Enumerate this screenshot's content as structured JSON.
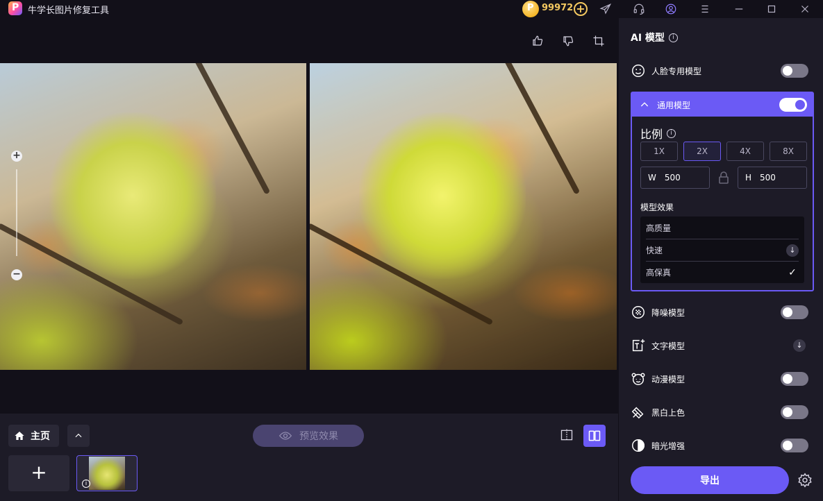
{
  "titlebar": {
    "app_title": "牛学长图片修复工具",
    "coin_count": "99972",
    "icons": [
      "send-icon",
      "headset-icon",
      "user-icon",
      "menu-icon",
      "minimize-icon",
      "maximize-icon",
      "close-icon"
    ]
  },
  "canvas": {
    "tools": [
      "thumbs-up-icon",
      "thumbs-down-icon",
      "crop-icon"
    ],
    "zoom": {
      "plus": "+",
      "minus": "−"
    }
  },
  "bottom": {
    "home_label": "主页",
    "preview_label": "预览效果",
    "add_label": "+",
    "thumbnail_info": "i"
  },
  "panel": {
    "title": "AI 模型",
    "models": {
      "face": {
        "label": "人脸专用模型",
        "enabled": false
      },
      "general": {
        "label": "通用模型",
        "enabled": true
      },
      "denoise": {
        "label": "降噪模型",
        "enabled": false
      },
      "text": {
        "label": "文字模型",
        "download": true
      },
      "anime": {
        "label": "动漫模型",
        "enabled": false
      },
      "colorize": {
        "label": "黑白上色",
        "enabled": false
      },
      "lowlight": {
        "label": "暗光增强",
        "enabled": false
      }
    },
    "scale": {
      "title": "比例",
      "options": [
        "1X",
        "2X",
        "4X",
        "8X"
      ],
      "selected": "2X",
      "width_label": "W",
      "width_value": "500",
      "height_label": "H",
      "height_value": "500"
    },
    "effect": {
      "title": "模型效果",
      "items": [
        "高质量",
        "快速",
        "高保真"
      ],
      "selected": "高保真"
    },
    "export_label": "导出"
  },
  "colors": {
    "accent": "#6b5af5",
    "panel_bg": "#1d1b27",
    "app_bg": "#121019",
    "coin": "#f3c860"
  }
}
